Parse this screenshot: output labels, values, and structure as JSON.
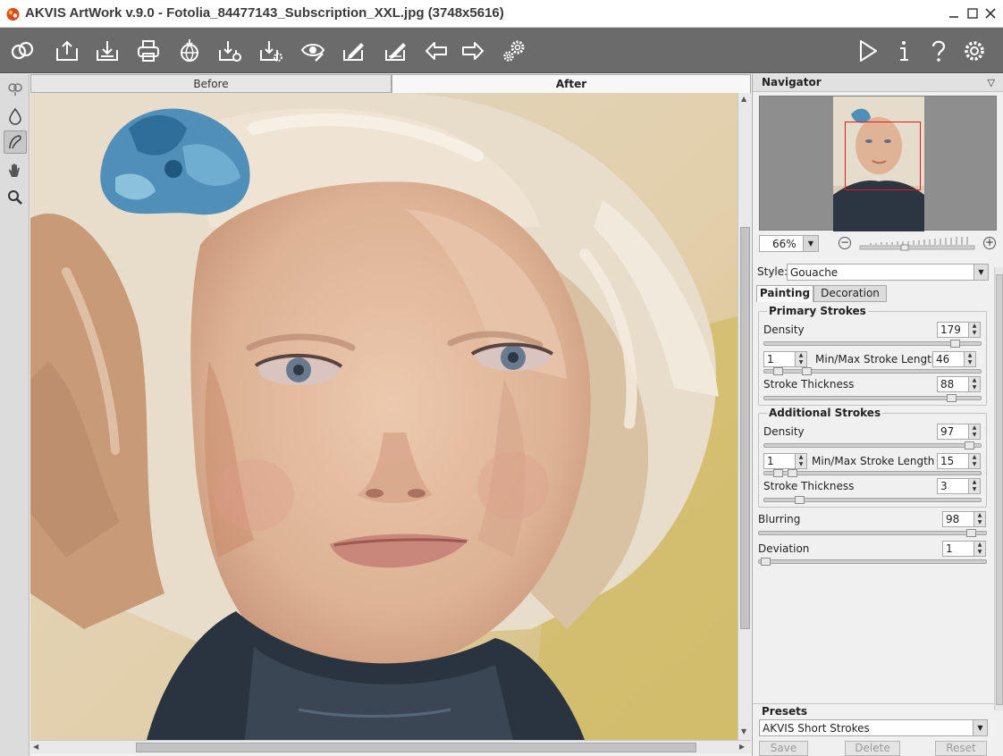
{
  "window": {
    "title": "AKVIS ArtWork v.9.0 - Fotolia_84477143_Subscription_XXL.jpg (3748x5616)",
    "controls": [
      "minimize-icon",
      "maximize-icon",
      "close-icon"
    ]
  },
  "toolbar": {
    "left_icons": [
      "app-logo-icon",
      "open-icon",
      "save-icon",
      "print-icon",
      "share-icon",
      "batch-icon",
      "plugin-icon",
      "preview-icon",
      "brush-edit-icon",
      "brush-save-icon",
      "undo-arrow-icon",
      "redo-arrow-icon",
      "settings-gears-icon"
    ],
    "right_icons": [
      "run-icon",
      "info-icon",
      "help-icon",
      "preferences-icon"
    ]
  },
  "tools": [
    "sample-icon",
    "drop-icon",
    "stroke-icon",
    "hand-icon",
    "zoom-icon"
  ],
  "view_tabs": {
    "before": "Before",
    "after": "After"
  },
  "navigator": {
    "title": "Navigator",
    "zoom": "66%"
  },
  "settings": {
    "style_label": "Style:",
    "style_value": "Gouache",
    "tabs": {
      "painting": "Painting",
      "decoration": "Decoration"
    },
    "primary": {
      "title": "Primary Strokes",
      "density_label": "Density",
      "density": "179",
      "min_length": "1",
      "length_label": "Min/Max Stroke Length",
      "max_length": "46",
      "thickness_label": "Stroke Thickness",
      "thickness": "88"
    },
    "additional": {
      "title": "Additional Strokes",
      "density_label": "Density",
      "density": "97",
      "min_length": "1",
      "length_label": "Min/Max Stroke Length",
      "max_length": "15",
      "thickness_label": "Stroke Thickness",
      "thickness": "3"
    },
    "blurring_label": "Blurring",
    "blurring": "98",
    "deviation_label": "Deviation",
    "deviation": "1"
  },
  "presets": {
    "title": "Presets",
    "selected": "AKVIS Short Strokes",
    "save": "Save",
    "delete": "Delete",
    "reset": "Reset"
  }
}
